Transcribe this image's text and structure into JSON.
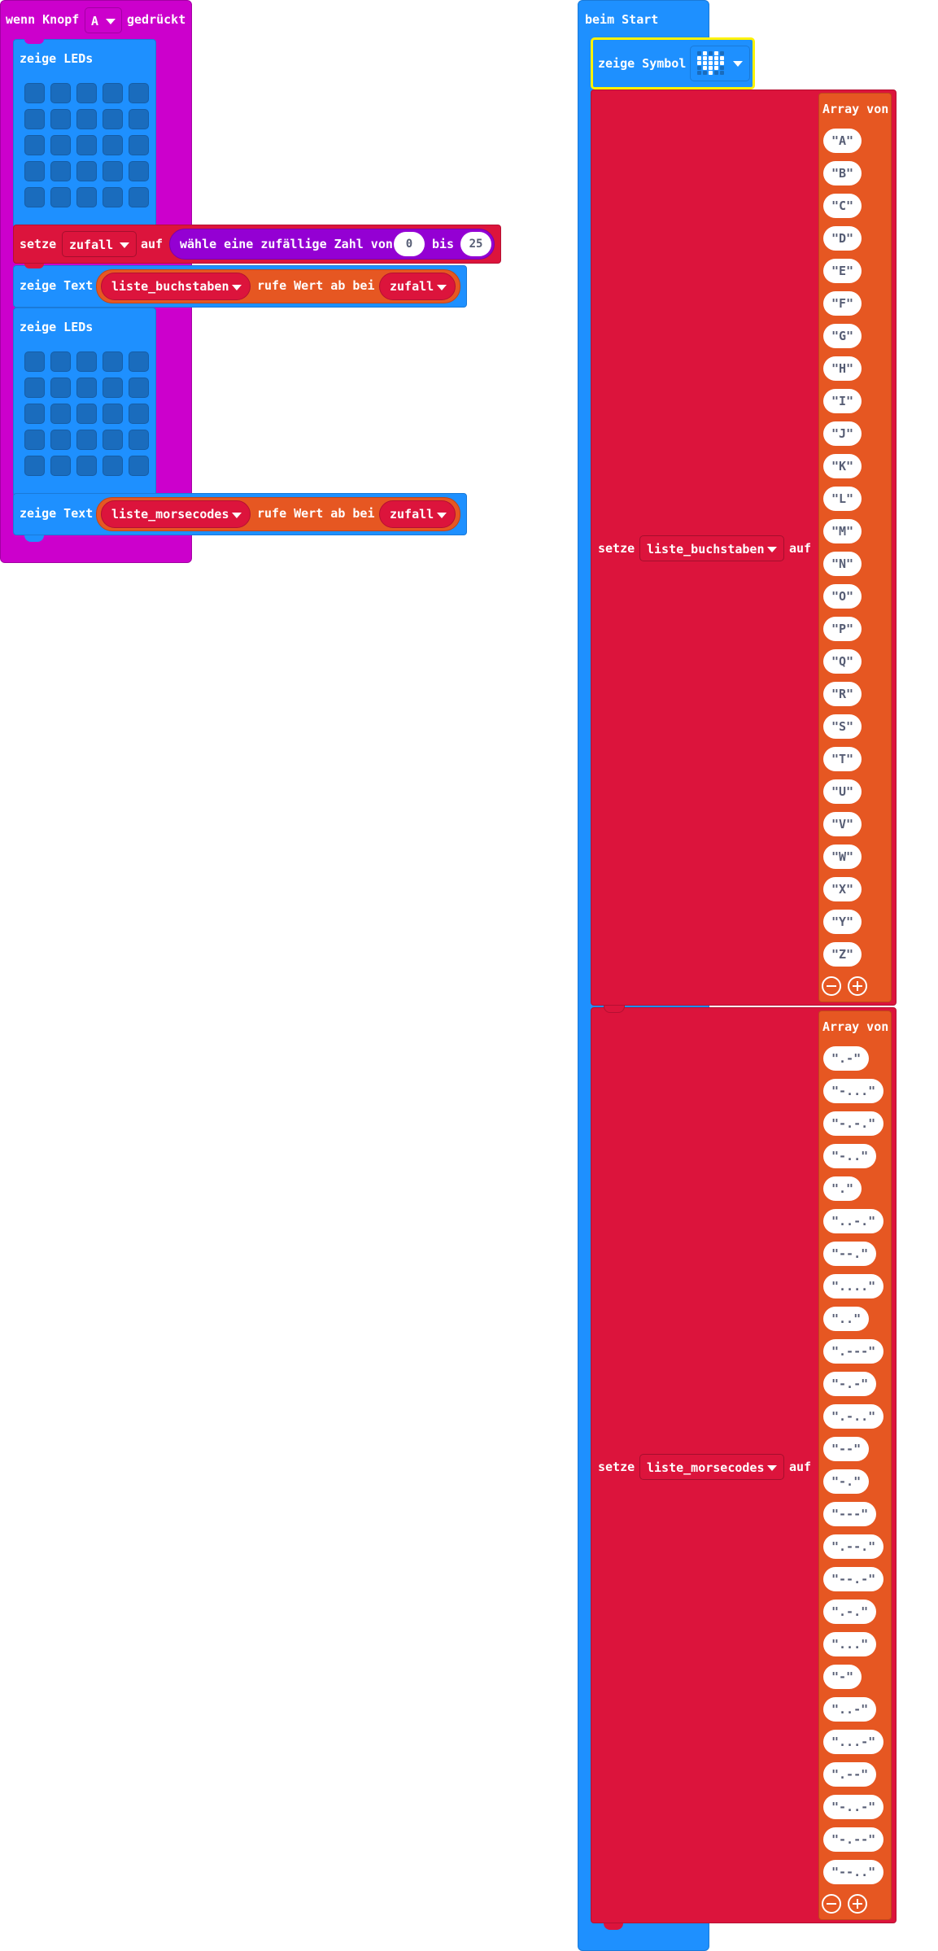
{
  "colors": {
    "event": "#cc00cc",
    "basic": "#1e90ff",
    "variables": "#dc143c",
    "arrays": "#e65722",
    "math": "#9400d3",
    "highlight": "#fff200"
  },
  "button_event": {
    "prefix": "wenn Knopf",
    "button": "A",
    "suffix": "gedrückt",
    "show_leds_1": "zeige LEDs",
    "set_block": {
      "setze": "setze",
      "variable": "zufall",
      "auf": "auf",
      "random_label": "wähle eine zufällige Zahl von",
      "from": "0",
      "bis": "bis",
      "to": "25"
    },
    "show_text_1": {
      "label": "zeige Text",
      "list": "liste_buchstaben",
      "get_label": "rufe Wert ab bei",
      "index_var": "zufall"
    },
    "show_leds_2": "zeige LEDs",
    "show_text_2": {
      "label": "zeige Text",
      "list": "liste_morsecodes",
      "get_label": "rufe Wert ab bei",
      "index_var": "zufall"
    }
  },
  "start_event": {
    "title": "beim Start",
    "show_symbol": "zeige Symbol",
    "symbol_icon": "heart-icon",
    "set_letters": {
      "setze": "setze",
      "variable": "liste_buchstaben",
      "auf": "auf",
      "array_label": "Array von",
      "items": [
        "\"A\"",
        "\"B\"",
        "\"C\"",
        "\"D\"",
        "\"E\"",
        "\"F\"",
        "\"G\"",
        "\"H\"",
        "\"I\"",
        "\"J\"",
        "\"K\"",
        "\"L\"",
        "\"M\"",
        "\"N\"",
        "\"O\"",
        "\"P\"",
        "\"Q\"",
        "\"R\"",
        "\"S\"",
        "\"T\"",
        "\"U\"",
        "\"V\"",
        "\"W\"",
        "\"X\"",
        "\"Y\"",
        "\"Z\""
      ]
    },
    "set_morse": {
      "setze": "setze",
      "variable": "liste_morsecodes",
      "auf": "auf",
      "array_label": "Array von",
      "items": [
        "\".-\"",
        "\"-...\"",
        "\"-.-.\"",
        "\"-..\"",
        "\".\"",
        "\"..-.\"",
        "\"--.\"",
        "\"....\"",
        "\"..\"",
        "\".---\"",
        "\"-.-\"",
        "\".-..\"",
        "\"--\"",
        "\"-.\"",
        "\"---\"",
        "\".--.\"",
        "\"--.-\"",
        "\".-.\"",
        "\"...\"",
        "\"-\"",
        "\"..-\"",
        "\"...-\"",
        "\".--\"",
        "\"-..-\"",
        "\"-.--\"",
        "\"--..\""
      ]
    }
  }
}
